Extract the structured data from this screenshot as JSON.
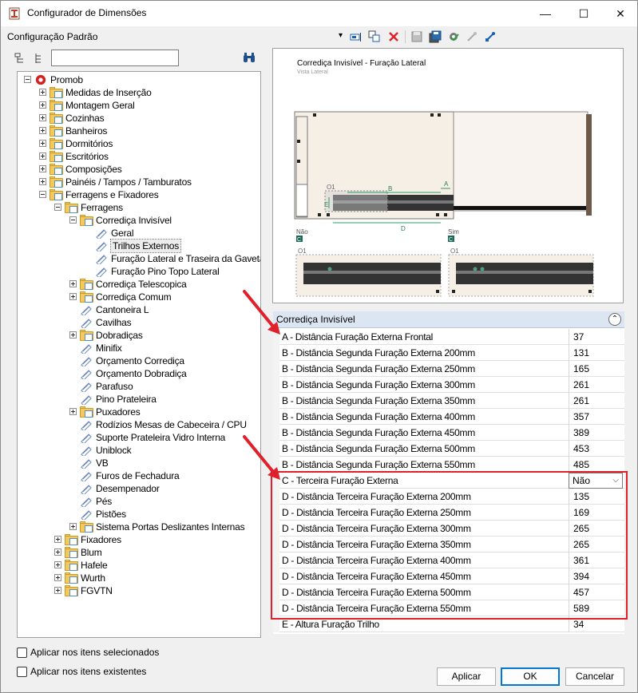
{
  "window": {
    "title": "Configurador de Dimensões",
    "minimize": "—",
    "maximize": "☐",
    "close": "✕"
  },
  "toolbar": {
    "config_label": "Configuração Padrão",
    "dropdown": "▾"
  },
  "tree": {
    "rows": [
      {
        "label": "Promob",
        "level": 0,
        "exp": "minus",
        "icon": "promob"
      },
      {
        "label": "Medidas de Inserção",
        "level": 1,
        "exp": "plus",
        "icon": "folder"
      },
      {
        "label": "Montagem Geral",
        "level": 1,
        "exp": "plus",
        "icon": "folder"
      },
      {
        "label": "Cozinhas",
        "level": 1,
        "exp": "plus",
        "icon": "folder"
      },
      {
        "label": "Banheiros",
        "level": 1,
        "exp": "plus",
        "icon": "folder"
      },
      {
        "label": "Dormitórios",
        "level": 1,
        "exp": "plus",
        "icon": "folder"
      },
      {
        "label": "Escritórios",
        "level": 1,
        "exp": "plus",
        "icon": "folder"
      },
      {
        "label": "Composições",
        "level": 1,
        "exp": "plus",
        "icon": "folder"
      },
      {
        "label": "Painéis / Tampos / Tamburatos",
        "level": 1,
        "exp": "plus",
        "icon": "folder"
      },
      {
        "label": "Ferragens e Fixadores",
        "level": 1,
        "exp": "minus",
        "icon": "folder"
      },
      {
        "label": "Ferragens",
        "level": 2,
        "exp": "minus",
        "icon": "folder"
      },
      {
        "label": "Corrediça Invisível",
        "level": 3,
        "exp": "minus",
        "icon": "folder"
      },
      {
        "label": "Geral",
        "level": 4,
        "exp": "",
        "icon": "item"
      },
      {
        "label": "Trilhos Externos",
        "level": 4,
        "exp": "",
        "icon": "item",
        "selected": true
      },
      {
        "label": "Furação Lateral e Traseira da Gaveta",
        "level": 4,
        "exp": "",
        "icon": "item"
      },
      {
        "label": "Furação Pino Topo Lateral",
        "level": 4,
        "exp": "",
        "icon": "item"
      },
      {
        "label": "Corrediça Telescopica",
        "level": 3,
        "exp": "plus",
        "icon": "folder"
      },
      {
        "label": "Corrediça Comum",
        "level": 3,
        "exp": "plus",
        "icon": "folder"
      },
      {
        "label": "Cantoneira L",
        "level": 3,
        "exp": "",
        "icon": "item"
      },
      {
        "label": "Cavilhas",
        "level": 3,
        "exp": "",
        "icon": "item"
      },
      {
        "label": "Dobradiças",
        "level": 3,
        "exp": "plus",
        "icon": "folder"
      },
      {
        "label": "Minifix",
        "level": 3,
        "exp": "",
        "icon": "item"
      },
      {
        "label": "Orçamento Corrediça",
        "level": 3,
        "exp": "",
        "icon": "item"
      },
      {
        "label": "Orçamento Dobradiça",
        "level": 3,
        "exp": "",
        "icon": "item"
      },
      {
        "label": "Parafuso",
        "level": 3,
        "exp": "",
        "icon": "item"
      },
      {
        "label": "Pino Prateleira",
        "level": 3,
        "exp": "",
        "icon": "item"
      },
      {
        "label": "Puxadores",
        "level": 3,
        "exp": "plus",
        "icon": "folder"
      },
      {
        "label": "Rodízios Mesas de Cabeceira / CPU",
        "level": 3,
        "exp": "",
        "icon": "item"
      },
      {
        "label": "Suporte Prateleira Vidro Interna",
        "level": 3,
        "exp": "",
        "icon": "item"
      },
      {
        "label": "Uniblock",
        "level": 3,
        "exp": "",
        "icon": "item"
      },
      {
        "label": "VB",
        "level": 3,
        "exp": "",
        "icon": "item"
      },
      {
        "label": "Furos de Fechadura",
        "level": 3,
        "exp": "",
        "icon": "item"
      },
      {
        "label": "Desempenador",
        "level": 3,
        "exp": "",
        "icon": "item"
      },
      {
        "label": "Pés",
        "level": 3,
        "exp": "",
        "icon": "item"
      },
      {
        "label": "Pistões",
        "level": 3,
        "exp": "",
        "icon": "item"
      },
      {
        "label": "Sistema Portas Deslizantes Internas",
        "level": 3,
        "exp": "plus",
        "icon": "folder"
      },
      {
        "label": "Fixadores",
        "level": 2,
        "exp": "plus",
        "icon": "folder"
      },
      {
        "label": "Blum",
        "level": 2,
        "exp": "plus",
        "icon": "folder"
      },
      {
        "label": "Hafele",
        "level": 2,
        "exp": "plus",
        "icon": "folder"
      },
      {
        "label": "Wurth",
        "level": 2,
        "exp": "plus",
        "icon": "folder"
      },
      {
        "label": "FGVTN",
        "level": 2,
        "exp": "plus",
        "icon": "folder"
      }
    ]
  },
  "preview": {
    "title": "Corrediça Invisível - Furação Lateral",
    "subtitle": "Vista Lateral",
    "label_o1": "O1",
    "label_a": "A",
    "label_b": "B",
    "label_d": "D",
    "label_e": "E",
    "label_nao": "Não",
    "label_sim": "Sim",
    "label_c": "C"
  },
  "properties": {
    "category": "Corrediça Invisível",
    "rows": [
      {
        "name": "A - Distância Furação Externa Frontal",
        "value": "37"
      },
      {
        "name": "B - Distância Segunda Furação Externa 200mm",
        "value": "131"
      },
      {
        "name": "B - Distância Segunda Furação Externa 250mm",
        "value": "165"
      },
      {
        "name": "B - Distância Segunda Furação Externa 300mm",
        "value": "261"
      },
      {
        "name": "B - Distância Segunda Furação Externa 350mm",
        "value": "261"
      },
      {
        "name": "B - Distância Segunda Furação Externa 400mm",
        "value": "357"
      },
      {
        "name": "B - Distância Segunda Furação Externa 450mm",
        "value": "389"
      },
      {
        "name": "B - Distância Segunda Furação Externa 500mm",
        "value": "453"
      },
      {
        "name": "B - Distância Segunda Furação Externa 550mm",
        "value": "485"
      },
      {
        "name": "C - Terceira Furação Externa",
        "value": "Não",
        "type": "select"
      },
      {
        "name": "D - Distância Terceira Furação Externa 200mm",
        "value": "135"
      },
      {
        "name": "D - Distância Terceira Furação Externa 250mm",
        "value": "169"
      },
      {
        "name": "D - Distância Terceira Furação Externa 300mm",
        "value": "265"
      },
      {
        "name": "D - Distância Terceira Furação Externa 350mm",
        "value": "265"
      },
      {
        "name": "D - Distância Terceira Furação Externa 400mm",
        "value": "361"
      },
      {
        "name": "D - Distância Terceira Furação Externa 450mm",
        "value": "394"
      },
      {
        "name": "D - Distância Terceira Furação Externa 500mm",
        "value": "457"
      },
      {
        "name": "D - Distância Terceira Furação Externa 550mm",
        "value": "589"
      },
      {
        "name": "E - Altura Furação Trilho",
        "value": "34"
      }
    ]
  },
  "options": {
    "apply_selected": "Aplicar nos itens selecionados",
    "apply_existing": "Aplicar nos itens existentes"
  },
  "buttons": {
    "apply": "Aplicar",
    "ok": "OK",
    "cancel": "Cancelar"
  },
  "colors": {
    "accent": "#0078d4",
    "highlight": "#e0202a",
    "folder": "#f5c85a"
  }
}
